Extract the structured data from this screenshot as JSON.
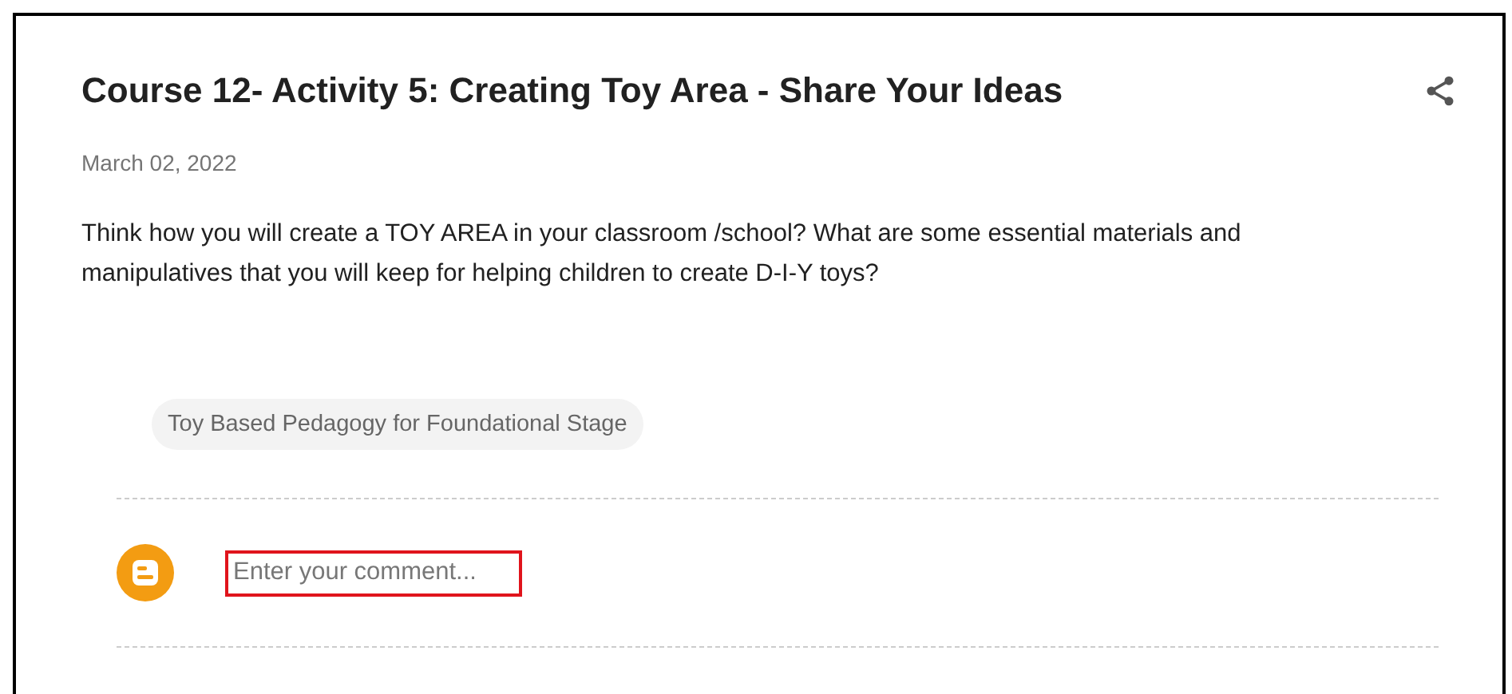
{
  "post": {
    "title": "Course 12- Activity 5: Creating Toy Area - Share Your Ideas",
    "date": "March 02, 2022",
    "body": "Think how you will create a TOY AREA in your classroom /school? What are some essential materials and manipulatives that you will keep for helping children to create D-I-Y toys?"
  },
  "labels": [
    "Toy Based Pedagogy for Foundational Stage"
  ],
  "comment": {
    "placeholder": "Enter your comment..."
  }
}
